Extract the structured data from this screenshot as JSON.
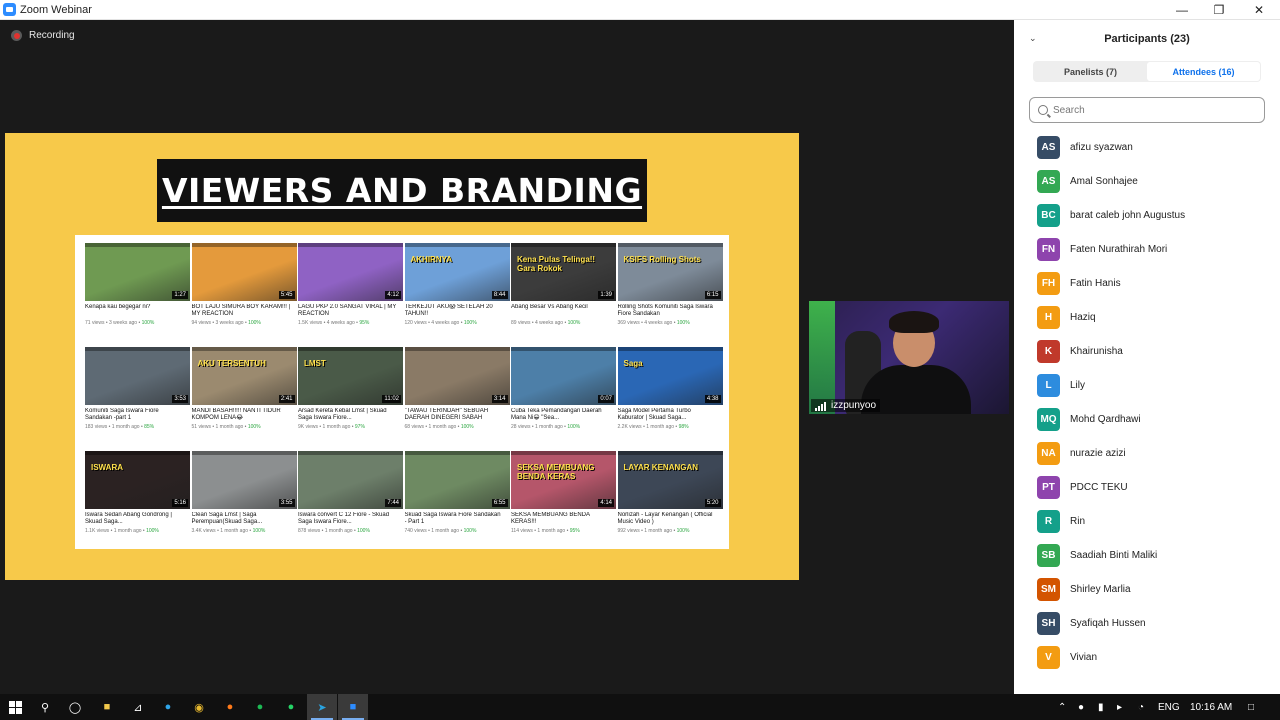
{
  "window": {
    "title": "Zoom Webinar"
  },
  "recording": {
    "label": "Recording"
  },
  "slide": {
    "title": "VIEWERS AND BRANDING",
    "videos": [
      {
        "title": "Kenapa kau begegar ni?",
        "duration": "1:27",
        "views": "71 views",
        "age": "3 weeks ago",
        "pct": "100%",
        "color": "#6f9a52",
        "overlay": ""
      },
      {
        "title": "BOT LAJU SIMURA BOY KARAM!!! | MY REACTION",
        "duration": "5:45",
        "views": "94 views",
        "age": "3 weeks ago",
        "pct": "100%",
        "color": "#e49a3c",
        "overlay": ""
      },
      {
        "title": "LAGU PKP 2.0 SANGAT VIRAL | MY REACTION",
        "duration": "4:12",
        "views": "1.5K views",
        "age": "4 weeks ago",
        "pct": "95%",
        "color": "#8f62c4",
        "overlay": ""
      },
      {
        "title": "TERKEJUT AKU😱 SETELAH 20 TAHUN!!",
        "duration": "8:44",
        "views": "120 views",
        "age": "4 weeks ago",
        "pct": "100%",
        "color": "#6ea0d8",
        "overlay": "AKHIRNYA"
      },
      {
        "title": "Abang Besar Vs Abang Kecil",
        "duration": "1:39",
        "views": "89 views",
        "age": "4 weeks ago",
        "pct": "100%",
        "color": "#3c3c3c",
        "overlay": "Kena Pulas Telinga!! Gara Rokok"
      },
      {
        "title": "Rolling Shots Komuniti Saga Iswara Fiore Sandakan",
        "duration": "6:15",
        "views": "369 views",
        "age": "4 weeks ago",
        "pct": "100%",
        "color": "#7e8b99",
        "overlay": "KSIFS Rolling Shots"
      },
      {
        "title": "Komuniti Saga Iswara Fiore Sandakan -part 1",
        "duration": "3:53",
        "views": "183 views",
        "age": "1 month ago",
        "pct": "85%",
        "color": "#5e6a74",
        "overlay": ""
      },
      {
        "title": "MANDI BASAH!!!!! NANTI TIDUR KOMPOM LENA😂",
        "duration": "2:41",
        "views": "51 views",
        "age": "1 month ago",
        "pct": "100%",
        "color": "#9b8a6f",
        "overlay": "AKU TERSENTUH"
      },
      {
        "title": "Arsad Kereta Kebal Lmst | Skuad Saga Iswara Fiore...",
        "duration": "11:02",
        "views": "9K views",
        "age": "1 month ago",
        "pct": "97%",
        "color": "#4a5a48",
        "overlay": "LMST"
      },
      {
        "title": "\"TAWAU TERINDAH\" SEBUAH DAERAH DINEGERI SABAH",
        "duration": "3:14",
        "views": "68 views",
        "age": "1 month ago",
        "pct": "100%",
        "color": "#8a7a66",
        "overlay": ""
      },
      {
        "title": "Cuba Teka Pemandangan Daerah Mana Ni😁 \"Sea...",
        "duration": "0:07",
        "views": "28 views",
        "age": "1 month ago",
        "pct": "100%",
        "color": "#4d7fa8",
        "overlay": ""
      },
      {
        "title": "Saga Model Pertama Turbo Kaburator | Skuad Saga...",
        "duration": "4:38",
        "views": "2.2K views",
        "age": "1 month ago",
        "pct": "98%",
        "color": "#2a67b5",
        "overlay": "Saga"
      },
      {
        "title": "Iswara Sedan Abang Gondrong | Skuad Saga...",
        "duration": "5:16",
        "views": "1.1K views",
        "age": "1 month ago",
        "pct": "100%",
        "color": "#2b2222",
        "overlay": "ISWARA"
      },
      {
        "title": "Clean Saga Lmst | Saga Perempuan(Skuad Saga...",
        "duration": "3:55",
        "views": "3.4K views",
        "age": "1 month ago",
        "pct": "100%",
        "color": "#8c8f90",
        "overlay": ""
      },
      {
        "title": "Iswara convert C 12 Fiore - Skuad Saga Iswara Fiore...",
        "duration": "7:44",
        "views": "878 views",
        "age": "1 month ago",
        "pct": "100%",
        "color": "#6d7f6a",
        "overlay": ""
      },
      {
        "title": "Skuad Saga Iswara Fiore Sandakan - Part 1",
        "duration": "6:55",
        "views": "740 views",
        "age": "1 month ago",
        "pct": "100%",
        "color": "#6e8a62",
        "overlay": ""
      },
      {
        "title": "SEKSA MEMBUANG BENDA KERAS!!!",
        "duration": "4:14",
        "views": "114 views",
        "age": "1 month ago",
        "pct": "95%",
        "color": "#b5566a",
        "overlay": "SEKSA MEMBUANG BENDA KERAS"
      },
      {
        "title": "Norlizah - Layar Kenangan ( Official Music Video )",
        "duration": "5:20",
        "views": "992 views",
        "age": "1 month ago",
        "pct": "100%",
        "color": "#3d4756",
        "overlay": "LAYAR KENANGAN"
      }
    ]
  },
  "speaker": {
    "name": "izzpunyoo"
  },
  "participants": {
    "title": "Participants (23)",
    "tabs": [
      {
        "label": "Panelists (7)",
        "active": false
      },
      {
        "label": "Attendees (16)",
        "active": true
      }
    ],
    "search_placeholder": "Search",
    "list": [
      {
        "initials": "AS",
        "name": "afizu syazwan",
        "color": "#364c66"
      },
      {
        "initials": "AS",
        "name": "Amal Sonhajee",
        "color": "#33a853"
      },
      {
        "initials": "BC",
        "name": "barat caleb john Augustus",
        "color": "#14a08a"
      },
      {
        "initials": "FN",
        "name": "Faten Nurathirah Mori",
        "color": "#8e44ad"
      },
      {
        "initials": "FH",
        "name": "Fatin Hanis",
        "color": "#f39c12"
      },
      {
        "initials": "H",
        "name": "Haziq",
        "color": "#f39c12"
      },
      {
        "initials": "K",
        "name": "Khairunisha",
        "color": "#c0392b"
      },
      {
        "initials": "L",
        "name": "Lily",
        "color": "#2d8cde"
      },
      {
        "initials": "MQ",
        "name": "Mohd Qardhawi",
        "color": "#14a08a"
      },
      {
        "initials": "NA",
        "name": "nurazie azizi",
        "color": "#f39c12"
      },
      {
        "initials": "PT",
        "name": "PDCC TEKU",
        "color": "#8e44ad"
      },
      {
        "initials": "R",
        "name": "Rin",
        "color": "#14a08a"
      },
      {
        "initials": "SB",
        "name": "Saadiah Binti Maliki",
        "color": "#33a853"
      },
      {
        "initials": "SM",
        "name": "Shirley Marlia",
        "color": "#d35400"
      },
      {
        "initials": "SH",
        "name": "Syafiqah Hussen",
        "color": "#364c66"
      },
      {
        "initials": "V",
        "name": "Vivian",
        "color": "#f39c12"
      }
    ]
  },
  "taskbar": {
    "language": "ENG",
    "time": "10:16 AM"
  }
}
